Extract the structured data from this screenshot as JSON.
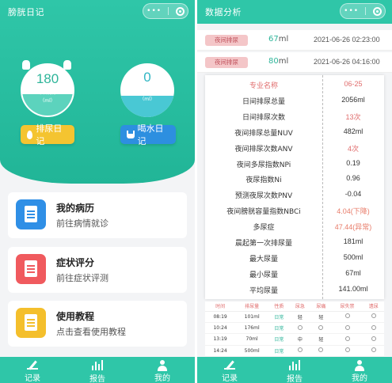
{
  "left": {
    "title": "膀胱日记",
    "capsule": {
      "dots": "•••"
    },
    "urine_today": {
      "value": "180",
      "label": "今日排尿",
      "unit": "（ml）",
      "level": 0.42
    },
    "water_today": {
      "value": "0",
      "label": "今日饮水",
      "unit": "（ml）",
      "level": 0.4
    },
    "urine_diary_button": "排尿日记",
    "water_diary_button": "喝水日记",
    "menu": [
      {
        "title": "我的病历",
        "subtitle": "前往病情就诊",
        "icon": "document-icon",
        "color": "#2f8fe6"
      },
      {
        "title": "症状评分",
        "subtitle": "前往症状评测",
        "icon": "clipboard-alert-icon",
        "color": "#f05a5e"
      },
      {
        "title": "使用教程",
        "subtitle": "点击查看使用教程",
        "icon": "tutorial-doc-icon",
        "color": "#f4bf2c"
      }
    ],
    "tabs": [
      {
        "label": "记录",
        "icon": "pen-icon"
      },
      {
        "label": "报告",
        "icon": "bar-chart-icon"
      },
      {
        "label": "我的",
        "icon": "user-icon"
      }
    ]
  },
  "right": {
    "title": "数据分析",
    "records": [
      {
        "badge": "夜间排尿",
        "amount": "67",
        "unit": "ml",
        "time": "2021-06-26 02:23:00"
      },
      {
        "badge": "夜间排尿",
        "amount": "80",
        "unit": "ml",
        "time": "2021-06-26 04:16:00"
      }
    ],
    "stats_header": {
      "label": "专业名称",
      "value": "06-25"
    },
    "stats": [
      {
        "label": "日间排尿总量",
        "value": "2056ml",
        "style": "normal"
      },
      {
        "label": "日间排尿次数",
        "value": "13次",
        "style": "warn"
      },
      {
        "label": "夜间排尿总量NUV",
        "value": "482ml",
        "style": "normal"
      },
      {
        "label": "夜间排尿次数ANV",
        "value": "4次",
        "style": "warn"
      },
      {
        "label": "夜间多尿指数NPi",
        "value": "0.19",
        "style": "normal"
      },
      {
        "label": "夜尿指数Ni",
        "value": "0.96",
        "style": "normal"
      },
      {
        "label": "预测夜尿次数PNV",
        "value": "-0.04",
        "style": "normal"
      },
      {
        "label": "夜间膀胱容量指数NBCi",
        "value": "4.04(下降)",
        "style": "alert"
      },
      {
        "label": "多尿症",
        "value": "47.44(异常)",
        "style": "alert"
      },
      {
        "label": "晨起第一次排尿量",
        "value": "181ml",
        "style": "normal"
      },
      {
        "label": "最大尿量",
        "value": "500ml",
        "style": "normal"
      },
      {
        "label": "最小尿量",
        "value": "67ml",
        "style": "normal"
      },
      {
        "label": "平均尿量",
        "value": "141.00ml",
        "style": "normal"
      }
    ],
    "log_headers": [
      "时间",
      "排尿量",
      "性质",
      "尿急",
      "尿痛",
      "尿失禁",
      "遗尿"
    ],
    "log_rows": [
      {
        "time": "08:19",
        "amount": "101ml",
        "type": "日常",
        "urgency": "轻",
        "pain": "轻"
      },
      {
        "time": "10:24",
        "amount": "176ml",
        "type": "日常",
        "urgency": "",
        "pain": ""
      },
      {
        "time": "13:19",
        "amount": "70ml",
        "type": "日常",
        "urgency": "中",
        "pain": "轻"
      },
      {
        "time": "14:24",
        "amount": "500ml",
        "type": "日常",
        "urgency": "",
        "pain": ""
      }
    ],
    "tabs": [
      {
        "label": "记录",
        "icon": "pen-icon"
      },
      {
        "label": "报告",
        "icon": "bar-chart-icon"
      },
      {
        "label": "我的",
        "icon": "user-icon"
      }
    ]
  }
}
